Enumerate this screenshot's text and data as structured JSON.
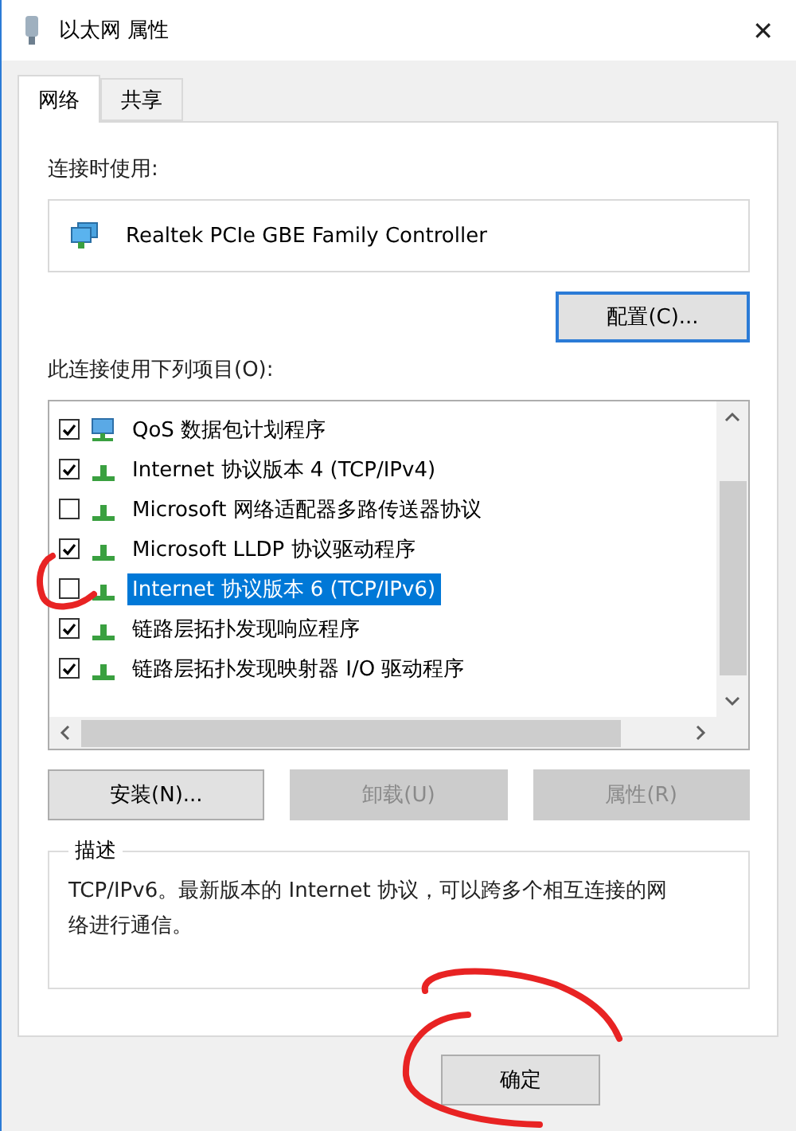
{
  "window": {
    "title": "以太网 属性",
    "close": "✕"
  },
  "tabs": [
    {
      "label": "网络",
      "selected": true
    },
    {
      "label": "共享",
      "selected": false
    }
  ],
  "connect_using": {
    "label": "连接时使用:",
    "adapter": "Realtek PCIe GBE Family Controller",
    "configure_button": "配置(C)..."
  },
  "items_label": "此连接使用下列项目(O):",
  "items": [
    {
      "kind": "scheduler",
      "label": "QoS 数据包计划程序",
      "checked": true,
      "selected": false
    },
    {
      "kind": "protocol",
      "label": "Internet 协议版本 4 (TCP/IPv4)",
      "checked": true,
      "selected": false
    },
    {
      "kind": "protocol",
      "label": "Microsoft 网络适配器多路传送器协议",
      "checked": false,
      "selected": false
    },
    {
      "kind": "protocol",
      "label": "Microsoft LLDP 协议驱动程序",
      "checked": true,
      "selected": false
    },
    {
      "kind": "protocol",
      "label": "Internet 协议版本 6 (TCP/IPv6)",
      "checked": false,
      "selected": true
    },
    {
      "kind": "protocol",
      "label": "链路层拓扑发现响应程序",
      "checked": true,
      "selected": false
    },
    {
      "kind": "protocol",
      "label": "链路层拓扑发现映射器 I/O 驱动程序",
      "checked": true,
      "selected": false
    }
  ],
  "item_buttons": [
    {
      "label": "安装(N)...",
      "disabled": false
    },
    {
      "label": "卸载(U)",
      "disabled": true
    },
    {
      "label": "属性(R)",
      "disabled": true
    }
  ],
  "description": {
    "title": "描述",
    "text": "TCP/IPv6。最新版本的 Internet 协议，可以跨多个相互连接的网络进行通信。"
  },
  "footer_buttons": [
    "确定"
  ]
}
